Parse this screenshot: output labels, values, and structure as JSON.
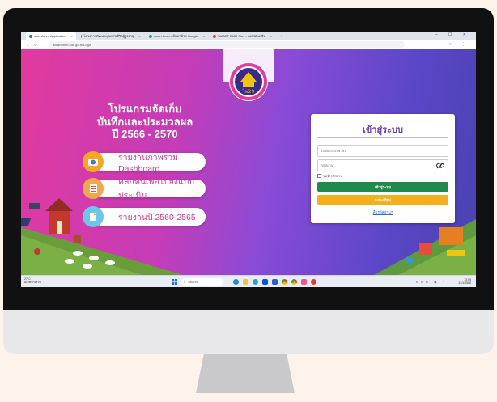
{
  "browser": {
    "tabs": [
      {
        "label": "smartbmm Application",
        "color": "#1a73e8",
        "active": true
      },
      {
        "label": "โครงการพัฒนาคุณภาพชีวิตผู้สูงอายุ",
        "color": "#4285f4",
        "active": false
      },
      {
        "label": "smart bmm - ค้นหาด้วย Google",
        "color": "#34a853",
        "active": false
      },
      {
        "label": "SMART BMM Plus - แอปพลิเคชั่น",
        "color": "#ea4335",
        "active": false
      }
    ],
    "new_tab": "+",
    "window_controls": "– ☐ ✕",
    "url": "smartbmm.cdd.go.th/Login",
    "nav_icons": "← → ⟳"
  },
  "hero": {
    "title_line1": "โปรแกรมจัดเก็บ",
    "title_line2": "บันทึกและประมวลผล",
    "title_line3": "ปี 2566 - 2570",
    "menu": [
      {
        "label": "รายงานภาพรวม Dashboard",
        "icon": "dashboard-icon"
      },
      {
        "label": "คลิกที่นี่เพื่อไปยังแบบประเมิน",
        "icon": "checklist-icon"
      },
      {
        "label": "รายงานปี 2560-2565",
        "icon": "report-icon"
      }
    ],
    "logo_text": "ไพ29"
  },
  "login": {
    "title": "เข้าสู่ระบบ",
    "username_placeholder": "เลขบัตรประชาชน",
    "password_placeholder": "รหัสผ่าน",
    "remember_label": "จดจำรหัสผ่าน",
    "login_button": "เข้าสู่ระบบ",
    "register_button": "ลงทะเบียน",
    "forgot_link": "ลืมรหัสผ่าน?",
    "colors": {
      "login": "#1f8a4c",
      "register": "#f2b01e",
      "title": "#6a3fb2"
    }
  },
  "taskbar": {
    "weather_temp": "27°C",
    "weather_desc": "มีเมฆบางส่วน",
    "search_label": "Search",
    "time": "13:55",
    "date": "22/1/2568",
    "lang": "ENG"
  }
}
